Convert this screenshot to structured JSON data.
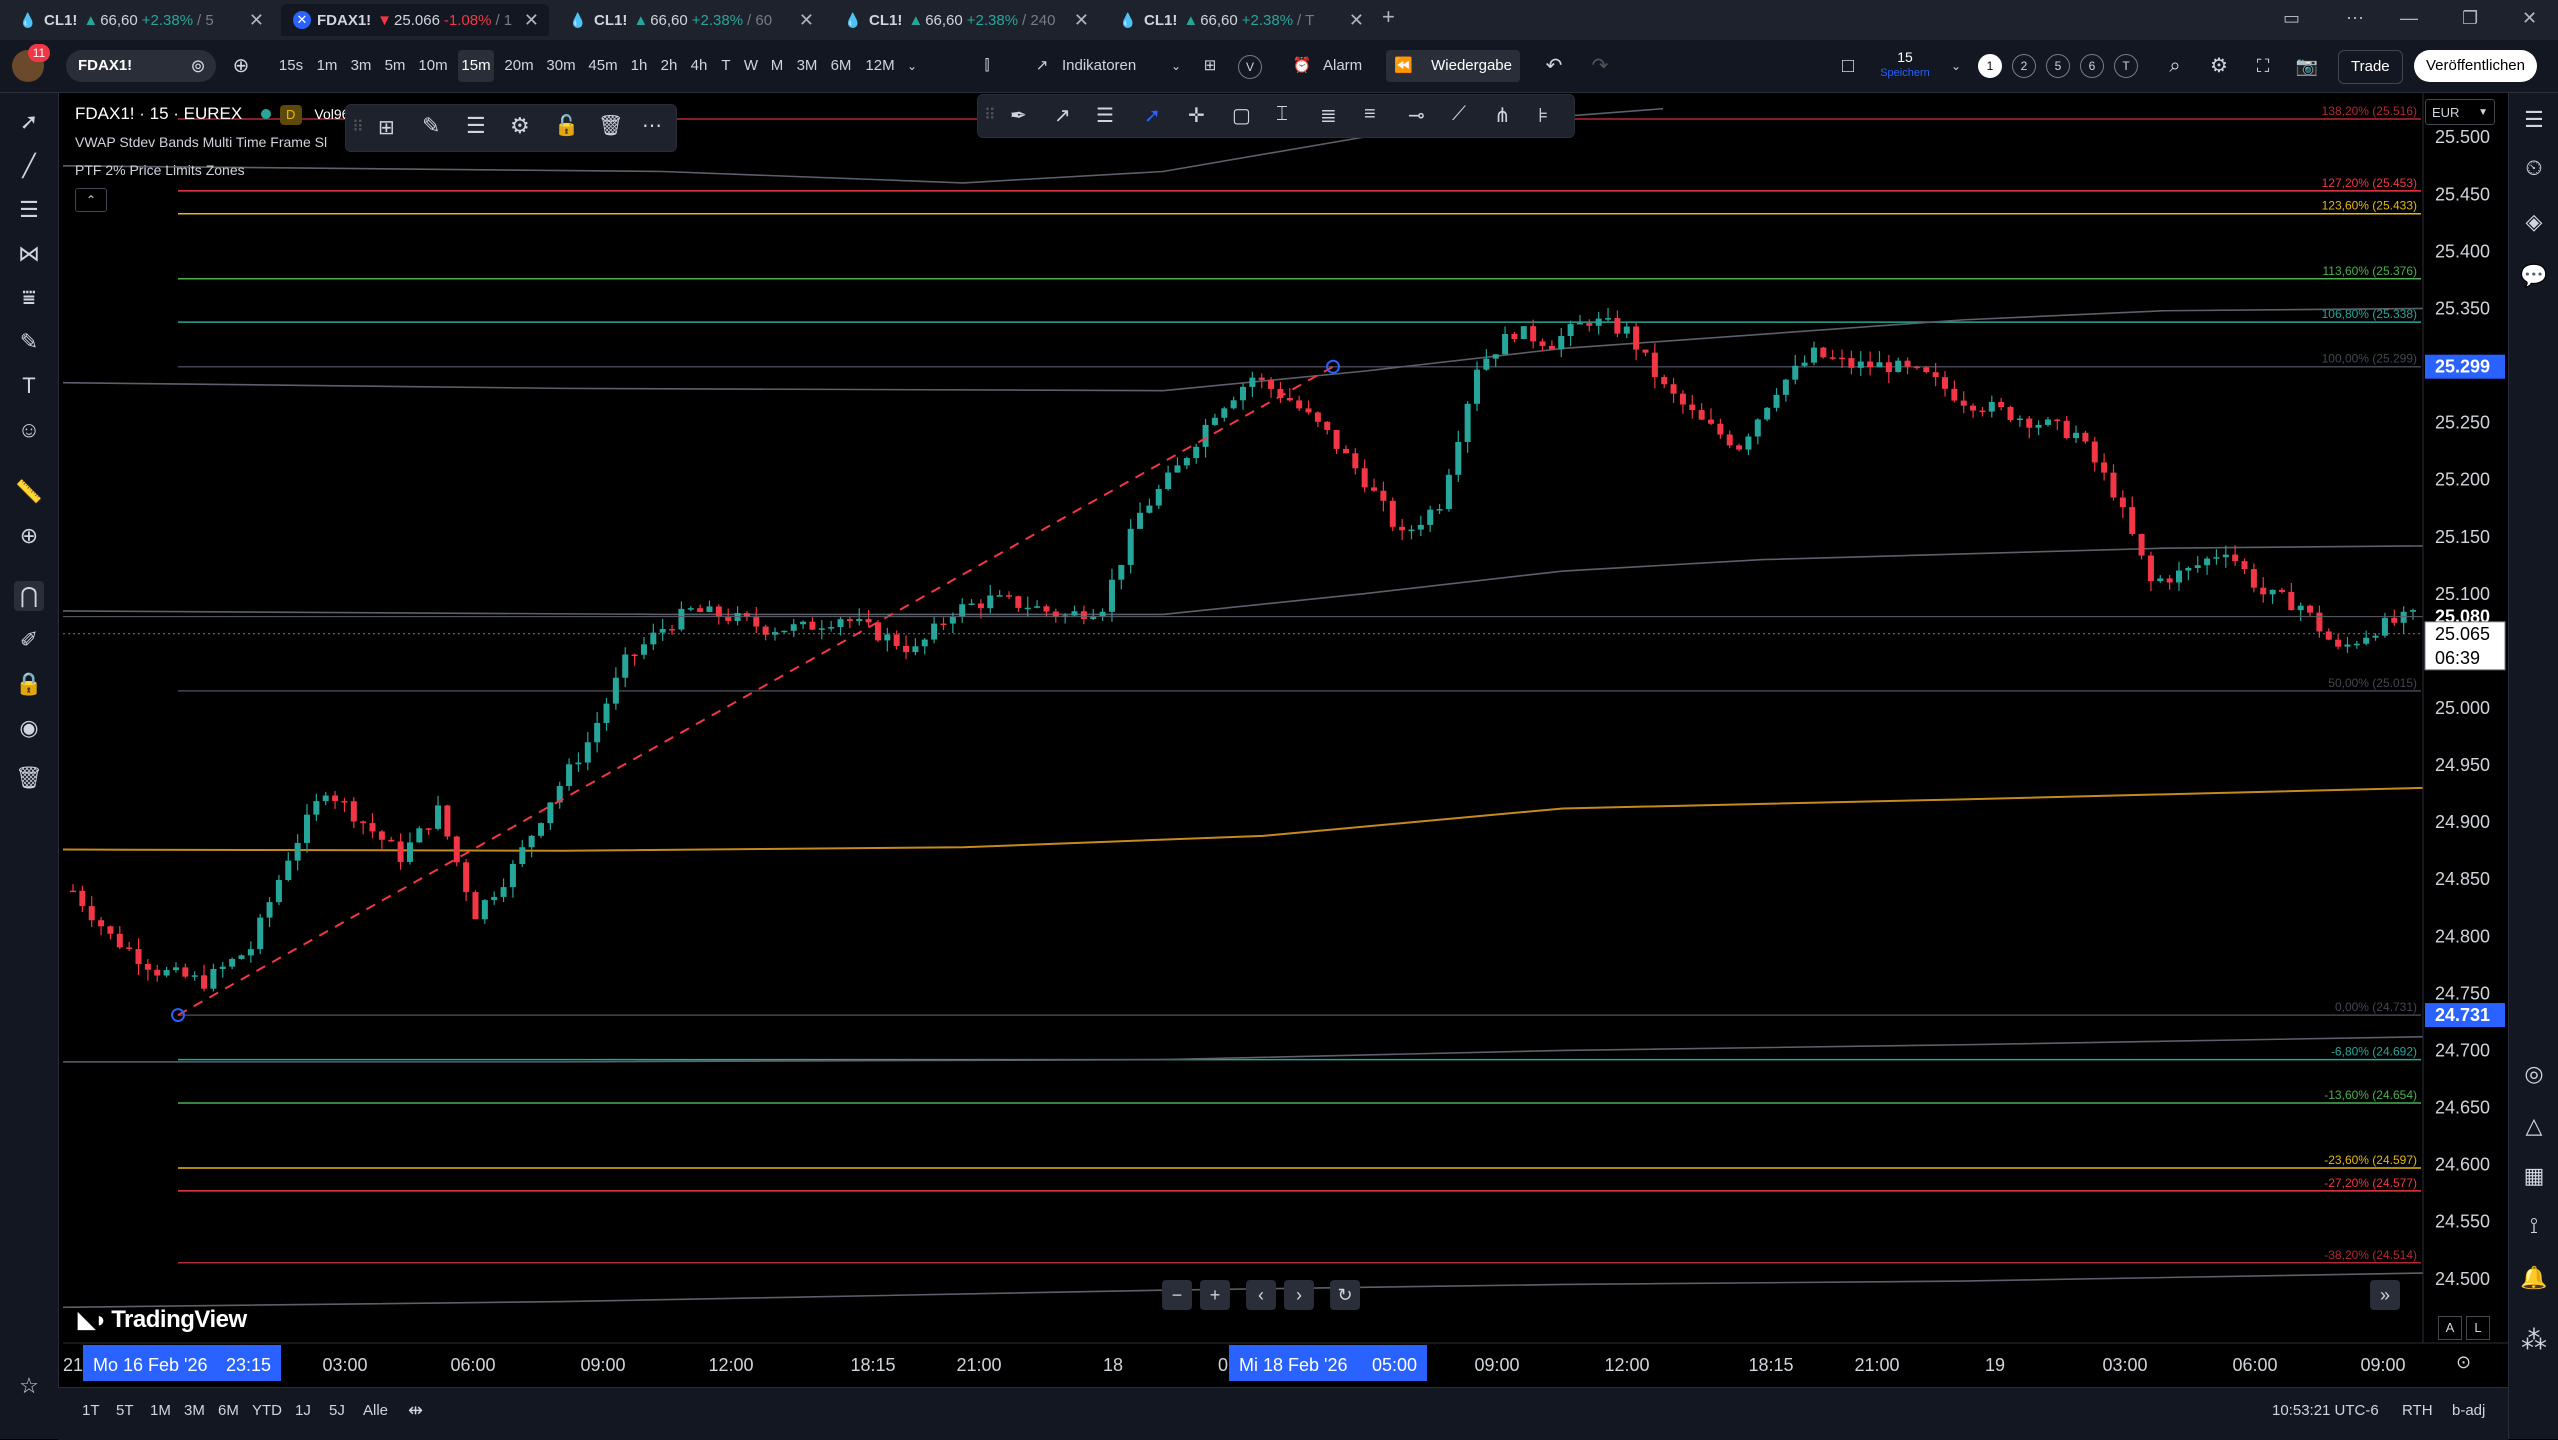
{
  "tabs": [
    {
      "symbol": "CL1!",
      "dir": "up",
      "arrow": "▲",
      "price": "66,60",
      "change": "+2.38%",
      "interval": "/ 5",
      "icon": "drop"
    },
    {
      "symbol": "FDAX1!",
      "dir": "dn",
      "arrow": "▼",
      "price": "25.066",
      "change": "-1.08%",
      "interval": "/ 1",
      "icon": "x"
    },
    {
      "symbol": "CL1!",
      "dir": "up",
      "arrow": "▲",
      "price": "66,60",
      "change": "+2.38%",
      "interval": "/ 60",
      "icon": "drop"
    },
    {
      "symbol": "CL1!",
      "dir": "up",
      "arrow": "▲",
      "price": "66,60",
      "change": "+2.38%",
      "interval": "/ 240",
      "icon": "drop"
    },
    {
      "symbol": "CL1!",
      "dir": "up",
      "arrow": "▲",
      "price": "66,60",
      "change": "+2.38%",
      "interval": "/ T",
      "icon": "drop"
    }
  ],
  "toolbar": {
    "avatar_badge": "11",
    "symbol": "FDAX1!",
    "intervals": [
      "15s",
      "1m",
      "3m",
      "5m",
      "10m",
      "15m",
      "20m",
      "30m",
      "45m",
      "1h",
      "2h",
      "4h",
      "T",
      "W",
      "M",
      "3M",
      "6M",
      "12M"
    ],
    "selected_interval": "15m",
    "indicators_label": "Indikatoren",
    "templates_label": "V",
    "alarm_label": "Alarm",
    "replay_label": "Wiedergabe",
    "save_count": "15",
    "save_label": "Speichern",
    "layouts": [
      "1",
      "2",
      "5",
      "6",
      "T"
    ],
    "trade_label": "Trade",
    "publish_label": "Veröffentlichen"
  },
  "legend": {
    "symbol_line": "FDAX1! · 15 · EUREX",
    "badge": "D",
    "volume_label": "Vol96",
    "indicators": [
      "VWAP Stdev Bands Multi Time Frame Sl",
      "PTF 2% Price Limits Zones"
    ]
  },
  "currency": "EUR",
  "price_axis": {
    "labels": [
      "25.500",
      "25.450",
      "25.400",
      "25.350",
      "25.300",
      "25.250",
      "25.200",
      "25.150",
      "25.100",
      "25.000",
      "24.950",
      "24.900",
      "24.850",
      "24.800",
      "24.750",
      "24.700",
      "24.650",
      "24.600",
      "24.550",
      "24.500"
    ],
    "fib_high_label": "25.299",
    "fib_low_label": "24.731",
    "last_price": "25.080",
    "current_price": "25.065",
    "countdown": "06:39",
    "colors": {
      "down": "#f23645",
      "up": "#26a69a",
      "blue": "#2962ff"
    }
  },
  "fib_levels": [
    {
      "text": "138,20% (25.516)",
      "price": 25516,
      "color": "#b22833"
    },
    {
      "text": "127,20% (25.453)",
      "price": 25453,
      "color": "#f23645"
    },
    {
      "text": "123,60% (25.433)",
      "price": 25433,
      "color": "#e5b80b"
    },
    {
      "text": "113,60% (25.376)",
      "price": 25376,
      "color": "#4caf50"
    },
    {
      "text": "106,80% (25.338)",
      "price": 25338,
      "color": "#26a69a"
    },
    {
      "text": "100,00% (25.299)",
      "price": 25299,
      "color": "#434651"
    },
    {
      "text": "50,00% (25.015)",
      "price": 25015,
      "color": "#434651"
    },
    {
      "text": "0,00% (24.731)",
      "price": 24731,
      "color": "#434651"
    },
    {
      "text": "-6,80% (24.692)",
      "price": 24692,
      "color": "#26a69a"
    },
    {
      "text": "-13,60% (24.654)",
      "price": 24654,
      "color": "#4caf50"
    },
    {
      "text": "-23,60% (24.597)",
      "price": 24597,
      "color": "#e5b80b"
    },
    {
      "text": "-27,20% (24.577)",
      "price": 24577,
      "color": "#f23645"
    },
    {
      "text": "-38,20% (24.514)",
      "price": 24514,
      "color": "#b22833"
    }
  ],
  "time_axis": {
    "labels": [
      "21",
      "03:00",
      "06:00",
      "09:00",
      "12:00",
      "18:15",
      "21:00",
      "18",
      "0",
      "09:00",
      "12:00",
      "18:15",
      "21:00",
      "19",
      "03:00",
      "06:00",
      "09:00"
    ],
    "start_highlight": {
      "date": "Mo 16 Feb '26",
      "time": "23:15"
    },
    "end_highlight": {
      "date": "Mi 18 Feb '26",
      "time": "05:00"
    }
  },
  "chart_data": {
    "type": "candlestick",
    "symbol": "FDAX1!",
    "interval": "15",
    "ylim": [
      24470,
      25530
    ],
    "close_path": [
      [
        0,
        24840
      ],
      [
        4,
        24800
      ],
      [
        9,
        24770
      ],
      [
        14,
        24760
      ],
      [
        19,
        24790
      ],
      [
        23,
        24870
      ],
      [
        27,
        24930
      ],
      [
        31,
        24900
      ],
      [
        35,
        24870
      ],
      [
        39,
        24910
      ],
      [
        43,
        24820
      ],
      [
        47,
        24860
      ],
      [
        51,
        24920
      ],
      [
        55,
        24970
      ],
      [
        59,
        25040
      ],
      [
        63,
        25070
      ],
      [
        66,
        25085
      ],
      [
        70,
        25080
      ],
      [
        74,
        25070
      ],
      [
        78,
        25070
      ],
      [
        82,
        25080
      ],
      [
        86,
        25065
      ],
      [
        90,
        25050
      ],
      [
        94,
        25085
      ],
      [
        98,
        25095
      ],
      [
        102,
        25090
      ],
      [
        106,
        25080
      ],
      [
        110,
        25090
      ],
      [
        114,
        25170
      ],
      [
        118,
        25210
      ],
      [
        122,
        25260
      ],
      [
        126,
        25290
      ],
      [
        130,
        25270
      ],
      [
        134,
        25240
      ],
      [
        138,
        25200
      ],
      [
        142,
        25150
      ],
      [
        146,
        25180
      ],
      [
        150,
        25300
      ],
      [
        154,
        25330
      ],
      [
        158,
        25320
      ],
      [
        162,
        25340
      ],
      [
        166,
        25330
      ],
      [
        170,
        25280
      ],
      [
        174,
        25250
      ],
      [
        178,
        25230
      ],
      [
        182,
        25280
      ],
      [
        186,
        25310
      ],
      [
        190,
        25300
      ],
      [
        194,
        25300
      ],
      [
        198,
        25290
      ],
      [
        202,
        25270
      ],
      [
        206,
        25260
      ],
      [
        210,
        25250
      ],
      [
        214,
        25240
      ],
      [
        218,
        25190
      ],
      [
        222,
        25110
      ],
      [
        226,
        25120
      ],
      [
        230,
        25140
      ],
      [
        234,
        25100
      ],
      [
        238,
        25090
      ],
      [
        242,
        25050
      ],
      [
        246,
        25070
      ],
      [
        250,
        25080
      ]
    ],
    "fib_anchor_low": 24731,
    "fib_anchor_high": 25299
  },
  "bottombar": {
    "ranges": [
      "1T",
      "5T",
      "1M",
      "3M",
      "6M",
      "YTD",
      "1J",
      "5J",
      "Alle"
    ],
    "clock": "10:53:21 UTC-6",
    "session": "RTH",
    "adj": "b-adj",
    "scale_a": "A",
    "scale_l": "L"
  },
  "logo_text": "TradingView"
}
